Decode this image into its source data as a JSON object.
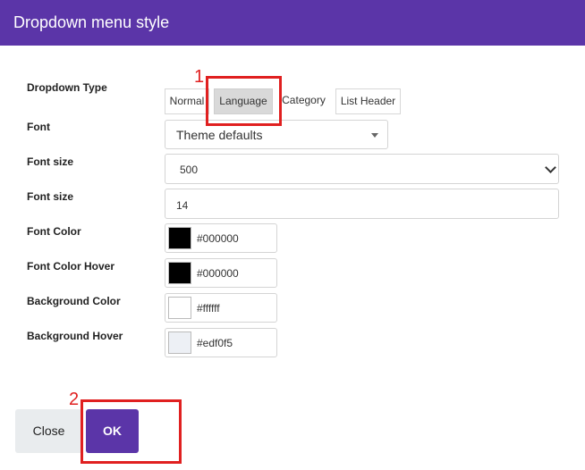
{
  "dialog": {
    "title": "Dropdown menu style"
  },
  "form": {
    "dropdown_type": {
      "label": "Dropdown Type",
      "options": [
        "Normal",
        "Language",
        "Category",
        "List Header"
      ],
      "selected": "Language"
    },
    "font": {
      "label": "Font",
      "value": "Theme defaults"
    },
    "font_weight": {
      "label": "Font size",
      "value": "500"
    },
    "font_size": {
      "label": "Font size",
      "value": "14"
    },
    "font_color": {
      "label": "Font Color",
      "value": "#000000",
      "swatch": "#000000"
    },
    "font_color_hover": {
      "label": "Font Color Hover",
      "value": "#000000",
      "swatch": "#000000"
    },
    "background_color": {
      "label": "Background Color",
      "value": "#ffffff",
      "swatch": "#ffffff"
    },
    "background_hover": {
      "label": "Background Hover",
      "value": "#edf0f5",
      "swatch": "#edf0f5"
    }
  },
  "footer": {
    "close_label": "Close",
    "ok_label": "OK"
  },
  "annotations": {
    "marker_1": "1",
    "marker_2": "2"
  },
  "colors": {
    "header": "#5b35a8",
    "ok_button": "#5b35a8",
    "close_button": "#e9ecee",
    "annotation": "#e02020"
  }
}
